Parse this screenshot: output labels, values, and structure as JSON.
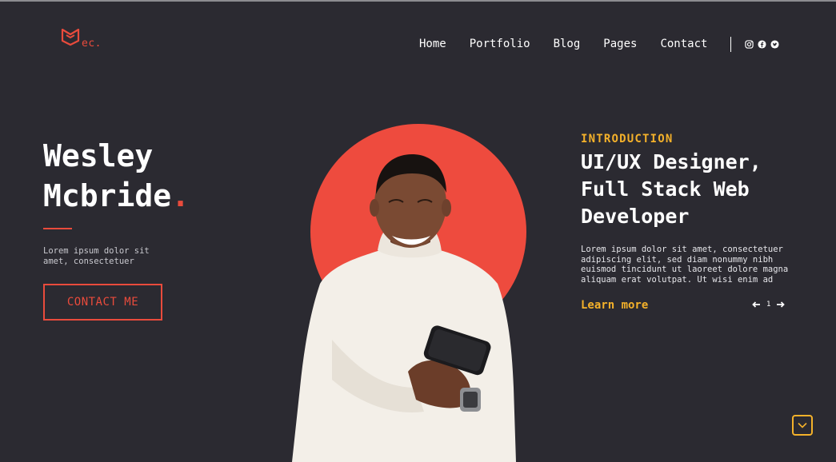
{
  "brand": {
    "logo_text": "ec.",
    "accent": "#e94b3c",
    "secondary_accent": "#f4b12a",
    "background": "#2b2a31"
  },
  "nav": {
    "items": [
      {
        "label": "Home"
      },
      {
        "label": "Portfolio"
      },
      {
        "label": "Blog"
      },
      {
        "label": "Pages"
      },
      {
        "label": "Contact"
      }
    ],
    "social_icons": [
      "instagram-icon",
      "facebook-icon",
      "twitter-icon"
    ]
  },
  "hero": {
    "name_line1": "Wesley",
    "name_line2": "Mcbride",
    "name_dot": ".",
    "subtitle": "Lorem ipsum dolor sit amet, consectetuer",
    "cta_label": "CONTACT ME"
  },
  "intro": {
    "kicker": "INTRODUCTION",
    "title": "UI/UX Designer, Full Stack Web Developer",
    "body": "Lorem ipsum dolor sit amet, consectetuer adipiscing elit, sed diam nonummy nibh euismod tincidunt ut laoreet dolore magna aliquam erat volutpat. Ut wisi enim ad",
    "learn_more_label": "Learn more",
    "page_number": "1"
  },
  "image": {
    "description_icon": "portrait-photo"
  }
}
